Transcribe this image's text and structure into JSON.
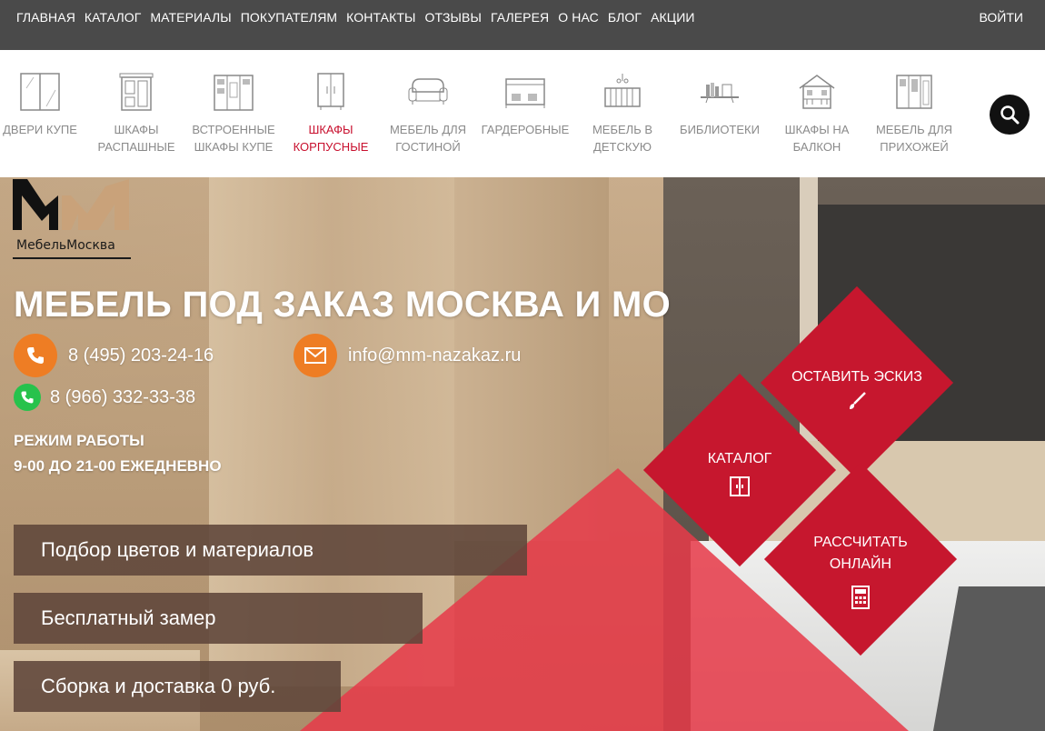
{
  "topnav": {
    "items": [
      "ГЛАВНАЯ",
      "КАТАЛОГ",
      "МАТЕРИАЛЫ",
      "ПОКУПАТЕЛЯМ",
      "КОНТАКТЫ",
      "ОТЗЫВЫ",
      "ГАЛЕРЕЯ",
      "О НАС",
      "БЛОГ",
      "АКЦИИ"
    ],
    "login": "ВОЙТИ"
  },
  "categories": [
    {
      "line1": "ДВЕРИ КУПЕ",
      "line2": "",
      "icon": "sliding-door-icon"
    },
    {
      "line1": "ШКАФЫ",
      "line2": "РАСПАШНЫЕ",
      "icon": "swing-wardrobe-icon"
    },
    {
      "line1": "ВСТРОЕННЫЕ",
      "line2": "ШКАФЫ КУПЕ",
      "icon": "built-in-wardrobe-icon"
    },
    {
      "line1": "ШКАФЫ",
      "line2": "КОРПУСНЫЕ",
      "icon": "cabinet-wardrobe-icon",
      "active": true
    },
    {
      "line1": "МЕБЕЛЬ ДЛЯ",
      "line2": "ГОСТИНОЙ",
      "icon": "sofa-icon"
    },
    {
      "line1": "ГАРДЕРОБНЫЕ",
      "line2": "",
      "icon": "dressing-room-icon"
    },
    {
      "line1": "МЕБЕЛЬ В",
      "line2": "ДЕТСКУЮ",
      "icon": "crib-icon"
    },
    {
      "line1": "БИБЛИОТЕКИ",
      "line2": "",
      "icon": "bookshelf-icon"
    },
    {
      "line1": "ШКАФЫ НА",
      "line2": "БАЛКОН",
      "icon": "balcony-house-icon"
    },
    {
      "line1": "МЕБЕЛЬ ДЛЯ",
      "line2": "ПРИХОЖЕЙ",
      "icon": "hallway-furniture-icon"
    }
  ],
  "logo": {
    "text": "МебельМосква"
  },
  "hero": {
    "headline": "МЕБЕЛЬ ПОД ЗАКАЗ МОСКВА И МО",
    "phone1": "8 (495) 203-24-16",
    "phone2": "8 (966) 332-33-38",
    "email": "info@mm-nazakaz.ru",
    "hours_title": "РЕЖИМ РАБОТЫ",
    "hours_value": "9-00 ДО 21-00 ЕЖЕДНЕВНО",
    "features": [
      "Подбор цветов и материалов",
      "Бесплатный замер",
      "Сборка и доставка 0 руб."
    ]
  },
  "actions": {
    "sketch": "ОСТАВИТЬ ЭСКИЗ",
    "catalog": "КАТАЛОГ",
    "calc_line1": "РАССЧИТАТЬ",
    "calc_line2": "ОНЛАЙН"
  },
  "colors": {
    "accent": "#c6172e",
    "orange": "#ee7d24",
    "whatsapp": "#27c24c",
    "topbar": "#4a4a4a"
  }
}
